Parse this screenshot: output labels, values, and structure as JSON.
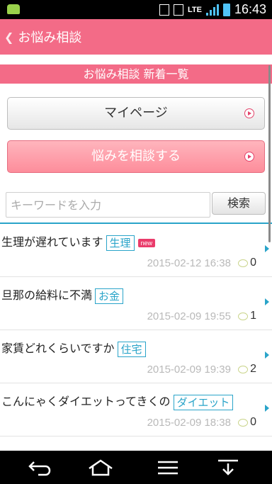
{
  "status_bar": {
    "time": "16:43",
    "network": "LTE"
  },
  "app_bar": {
    "title": "お悩み相談"
  },
  "section": {
    "heading": "お悩み相談 新着一覧"
  },
  "buttons": {
    "mypage": "マイページ",
    "consult": "悩みを相談する"
  },
  "search": {
    "placeholder": "キーワードを入力",
    "button": "検索"
  },
  "posts": [
    {
      "title": "生理が遅れています",
      "tag": "生理",
      "badge": "new",
      "date": "2015-02-12 16:38",
      "comments": "0"
    },
    {
      "title": "旦那の給料に不満",
      "tag": "お金",
      "badge": "",
      "date": "2015-02-09 19:55",
      "comments": "1"
    },
    {
      "title": "家賃どれくらいですか",
      "tag": "住宅",
      "badge": "",
      "date": "2015-02-09 19:39",
      "comments": "2"
    },
    {
      "title": "こんにゃくダイエットってきくの",
      "tag": "ダイエット",
      "badge": "",
      "date": "2015-02-09 18:38",
      "comments": "0"
    }
  ],
  "colors": {
    "accent": "#f36b87",
    "link": "#2aa4c9",
    "new_badge": "#ea3c6b"
  }
}
